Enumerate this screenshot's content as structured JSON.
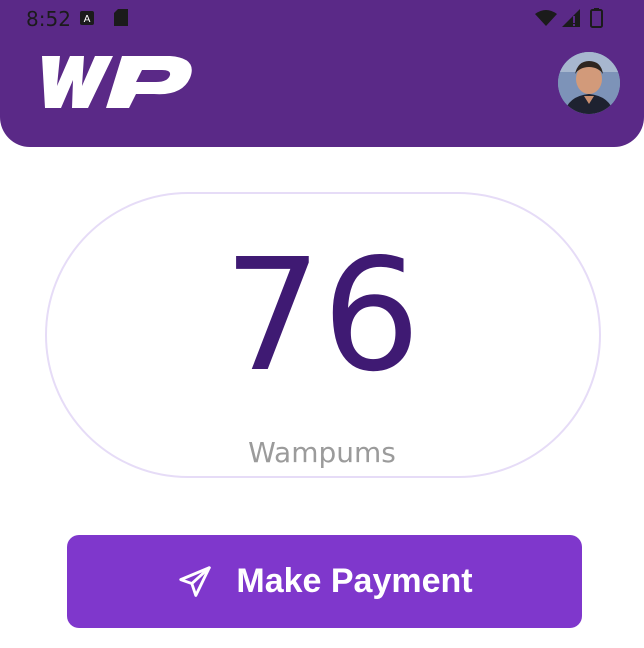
{
  "status_bar": {
    "time": "8:52",
    "icons": [
      "accessibility-a-icon",
      "sd-card-icon",
      "wifi-icon",
      "cell-signal-icon",
      "battery-icon"
    ]
  },
  "header": {
    "background_color": "#5a2987",
    "logo_text": "WP",
    "avatar_icon": "user-avatar-photo"
  },
  "balance": {
    "value": "76",
    "unit": "Wampums",
    "value_color": "#3f1a73"
  },
  "actions": {
    "make_payment_label": "Make Payment",
    "make_payment_icon": "send-paper-plane-icon",
    "button_color": "#7f37cc"
  }
}
